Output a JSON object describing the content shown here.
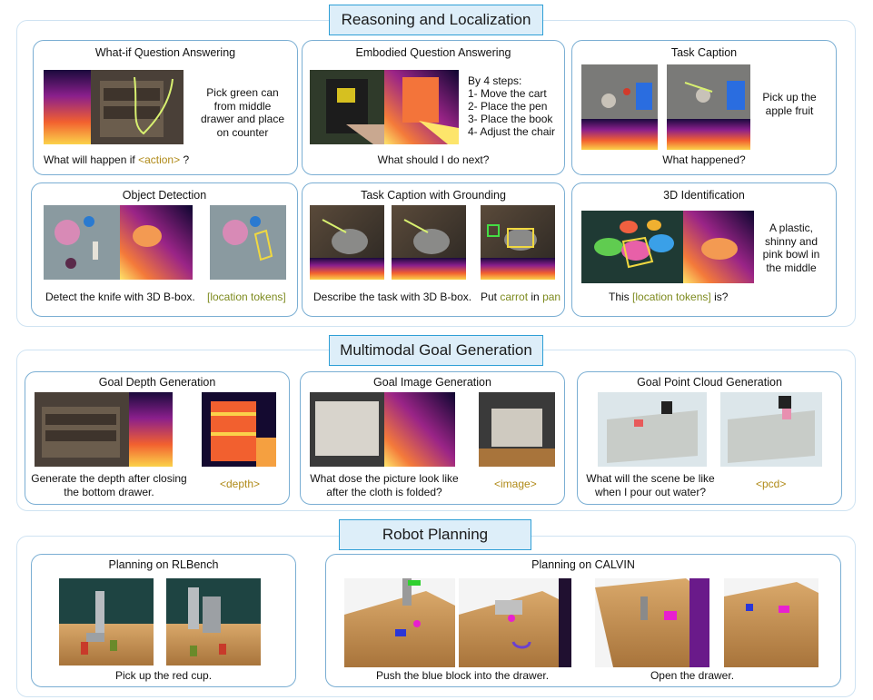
{
  "sections": {
    "reasoning": "Reasoning and Localization",
    "goal": "Multimodal Goal Generation",
    "planning": "Robot Planning"
  },
  "cards": {
    "whatif": {
      "title": "What-if Question Answering",
      "side": "Pick green can from middle drawer and place on counter",
      "q_prefix": "What will happen if ",
      "q_token": "<action>",
      "q_suffix": " ?"
    },
    "eqa": {
      "title": "Embodied Question Answering",
      "steps_head": "By 4 steps:",
      "steps": [
        "1-  Move the cart",
        "2-  Place the pen",
        "3-  Place the book",
        "4-  Adjust the chair"
      ],
      "question": "What should I do next?"
    },
    "taskcap": {
      "title": "Task Caption",
      "side": "Pick up the apple fruit",
      "question": "What happened?"
    },
    "objdet": {
      "title": "Object Detection",
      "question": "Detect the knife with 3D B-box.",
      "answer": "[location tokens]"
    },
    "tcg": {
      "title": "Task Caption with Grounding",
      "question": "Describe the task with 3D B-box.",
      "ans_put": "Put ",
      "ans_carrot": "carrot",
      "ans_in": " in ",
      "ans_pan": "pan"
    },
    "ident3d": {
      "title": "3D Identification",
      "side": "A plastic, shinny and pink bowl in the middle",
      "q_prefix": "This ",
      "q_token": "[location tokens]",
      "q_suffix": " is?"
    },
    "goaldepth": {
      "title": "Goal Depth Generation",
      "question": "Generate the depth after closing the bottom drawer.",
      "answer": "<depth>"
    },
    "goalimage": {
      "title": "Goal Image Generation",
      "question": "What dose the picture look like after the cloth is folded?",
      "answer": "<image>"
    },
    "goalpcd": {
      "title": "Goal Point Cloud Generation",
      "question": "What will the scene be like when I pour out water?",
      "answer": "<pcd>"
    },
    "rlbench": {
      "title": "Planning on RLBench",
      "caption": "Pick up the red cup."
    },
    "calvin": {
      "title": "Planning on CALVIN",
      "caption1": "Push the blue block into the drawer.",
      "caption2": "Open the drawer."
    }
  }
}
